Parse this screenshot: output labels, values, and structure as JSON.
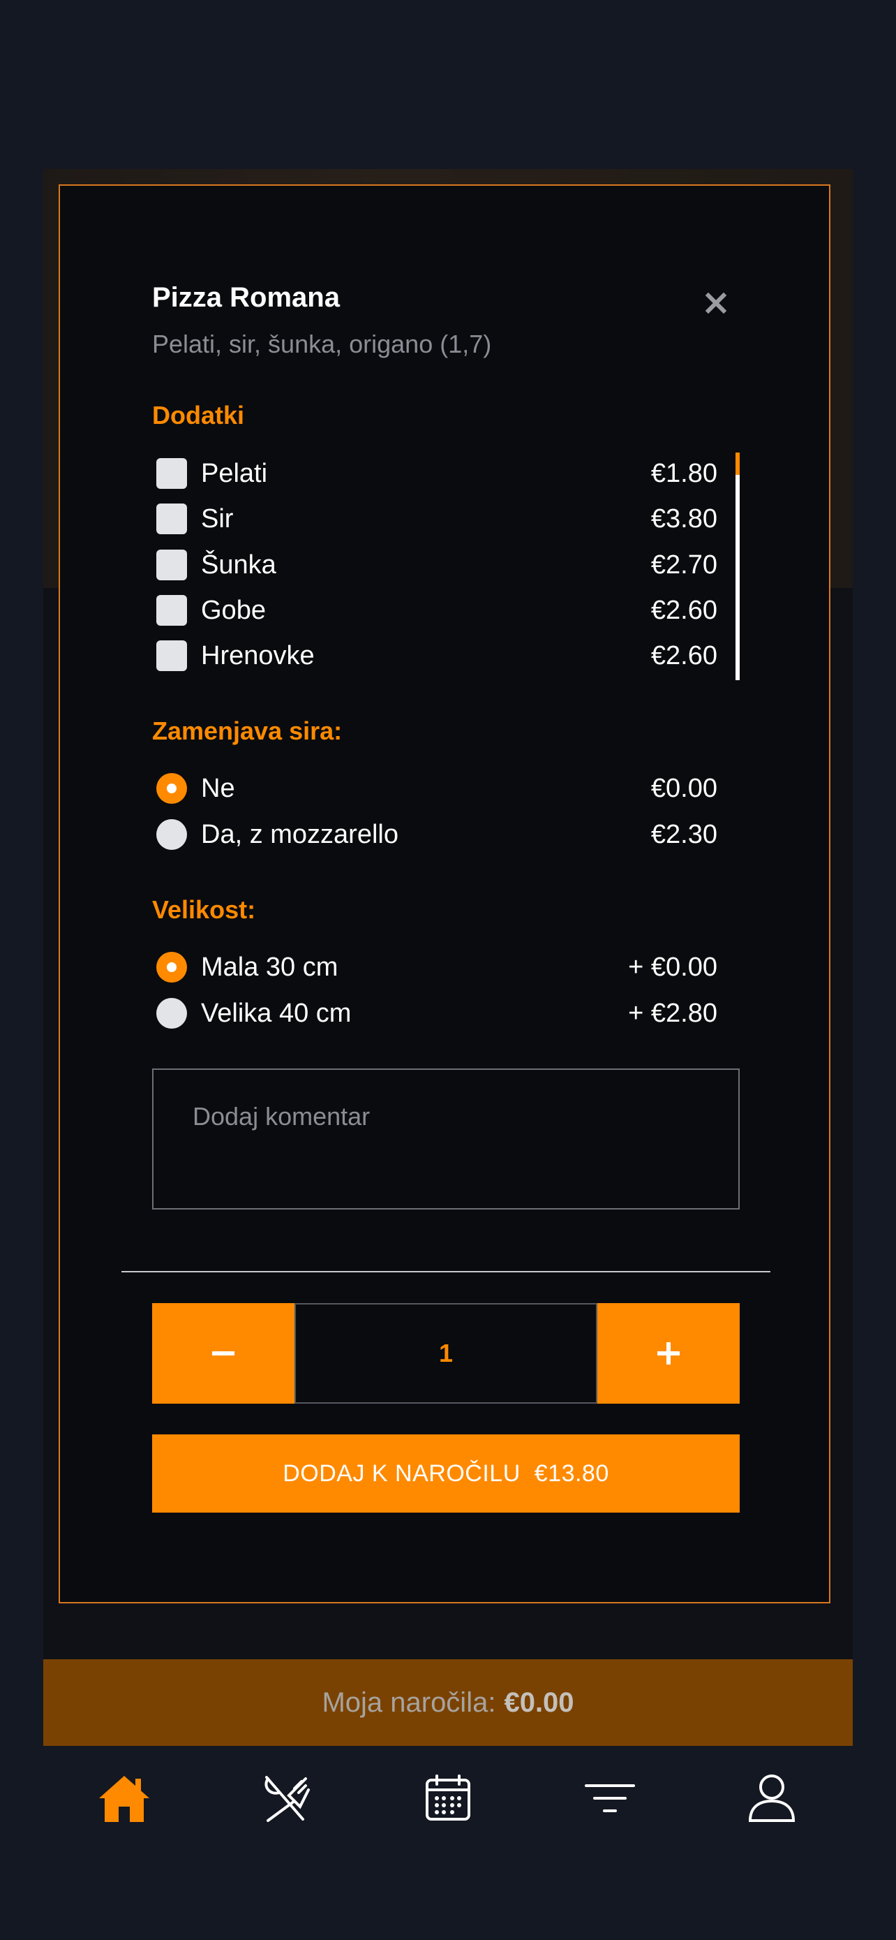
{
  "item": {
    "title": "Pizza Romana",
    "description": "Pelati, sir, šunka, origano (1,7)"
  },
  "sections": {
    "addons_title": "Dodatki",
    "cheese_title": "Zamenjava sira:",
    "size_title": "Velikost:"
  },
  "addons": [
    {
      "label": "Pelati",
      "price": "€1.80",
      "checked": false
    },
    {
      "label": "Sir",
      "price": "€3.80",
      "checked": false
    },
    {
      "label": "Šunka",
      "price": "€2.70",
      "checked": false
    },
    {
      "label": "Gobe",
      "price": "€2.60",
      "checked": false
    },
    {
      "label": "Hrenovke",
      "price": "€2.60",
      "checked": false
    }
  ],
  "cheese_options": [
    {
      "label": "Ne",
      "price": "€0.00",
      "selected": true
    },
    {
      "label": "Da, z mozzarello",
      "price": "€2.30",
      "selected": false
    }
  ],
  "size_options": [
    {
      "label": "Mala 30 cm",
      "price": "+ €0.00",
      "selected": true
    },
    {
      "label": "Velika 40 cm",
      "price": "+ €2.80",
      "selected": false
    }
  ],
  "comment": {
    "placeholder": "Dodaj komentar",
    "value": ""
  },
  "quantity": {
    "value": "1",
    "minus": "−",
    "plus": "+"
  },
  "add_button": {
    "label": "DODAJ K NAROČILU",
    "price": "€13.80"
  },
  "orders_bar": {
    "label": "Moja naročila:",
    "amount": "€0.00"
  },
  "tabbar": {
    "icons": [
      "home-icon",
      "utensils-icon",
      "calendar-icon",
      "filter-icon",
      "user-icon"
    ],
    "active": "home"
  },
  "colors": {
    "accent": "#ff8a00",
    "background": "#141822",
    "modal": "#0a0b0e"
  }
}
